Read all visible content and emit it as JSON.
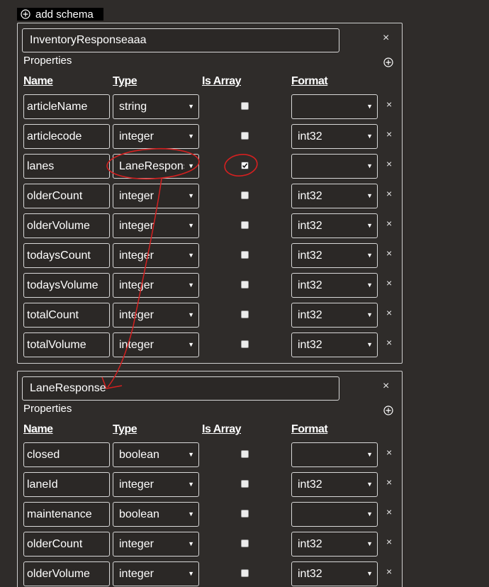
{
  "toolbar": {
    "add_schema_label": "add schema"
  },
  "headers": {
    "name": "Name",
    "type": "Type",
    "is_array": "Is Array",
    "format": "Format"
  },
  "schemas": [
    {
      "name": "InventoryResponseaaa",
      "properties_label": "Properties",
      "rows": [
        {
          "name": "articleName",
          "type": "string",
          "is_array": false,
          "format": ""
        },
        {
          "name": "articlecode",
          "type": "integer",
          "is_array": false,
          "format": "int32"
        },
        {
          "name": "lanes",
          "type": "LaneResponse",
          "is_array": true,
          "format": ""
        },
        {
          "name": "olderCount",
          "type": "integer",
          "is_array": false,
          "format": "int32"
        },
        {
          "name": "olderVolume",
          "type": "integer",
          "is_array": false,
          "format": "int32"
        },
        {
          "name": "todaysCount",
          "type": "integer",
          "is_array": false,
          "format": "int32"
        },
        {
          "name": "todaysVolume",
          "type": "integer",
          "is_array": false,
          "format": "int32"
        },
        {
          "name": "totalCount",
          "type": "integer",
          "is_array": false,
          "format": "int32"
        },
        {
          "name": "totalVolume",
          "type": "integer",
          "is_array": false,
          "format": "int32"
        }
      ]
    },
    {
      "name": "LaneResponse",
      "properties_label": "Properties",
      "rows": [
        {
          "name": "closed",
          "type": "boolean",
          "is_array": false,
          "format": ""
        },
        {
          "name": "laneId",
          "type": "integer",
          "is_array": false,
          "format": "int32"
        },
        {
          "name": "maintenance",
          "type": "boolean",
          "is_array": false,
          "format": ""
        },
        {
          "name": "olderCount",
          "type": "integer",
          "is_array": false,
          "format": "int32"
        },
        {
          "name": "olderVolume",
          "type": "integer",
          "is_array": false,
          "format": "int32"
        }
      ]
    }
  ],
  "icons": {
    "add": "circle-plus-icon",
    "remove": "close-icon",
    "dropdown": "caret-down-icon",
    "check": "check-icon"
  },
  "colors": {
    "background": "#2f2c2a",
    "annotation": "#d42020",
    "border": "#d8d8d8"
  }
}
